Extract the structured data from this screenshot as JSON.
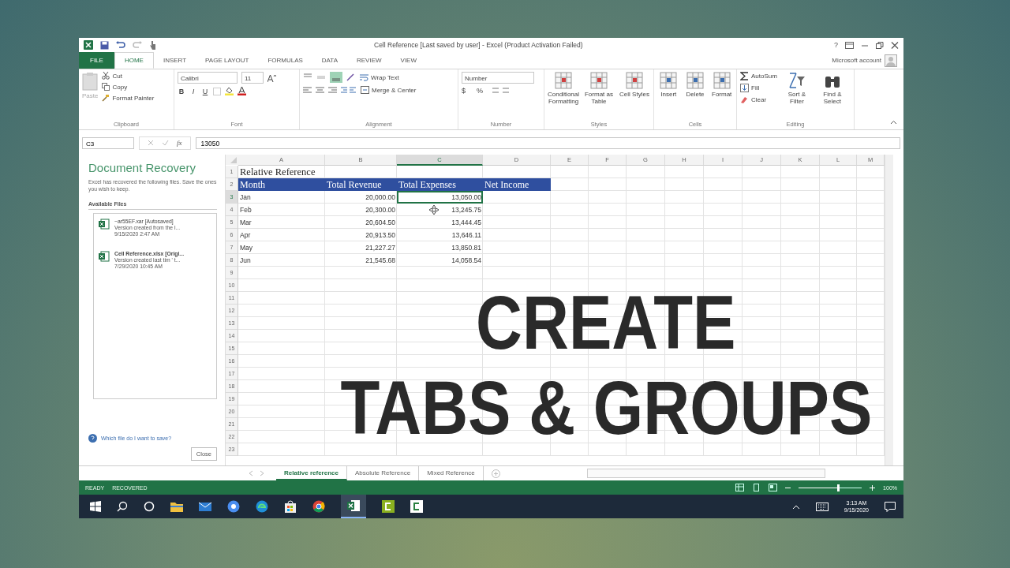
{
  "window": {
    "title": "Cell Reference [Last saved by user] - Excel (Product Activation Failed)",
    "help": "?",
    "account": "Microsoft account"
  },
  "ribbon_tabs": [
    {
      "label": "FILE",
      "kind": "file",
      "selected": false
    },
    {
      "label": "HOME",
      "kind": "tab",
      "selected": true
    },
    {
      "label": "INSERT",
      "kind": "tab",
      "selected": false
    },
    {
      "label": "PAGE LAYOUT",
      "kind": "tab",
      "selected": false
    },
    {
      "label": "FORMULAS",
      "kind": "tab",
      "selected": false
    },
    {
      "label": "DATA",
      "kind": "tab",
      "selected": false
    },
    {
      "label": "REVIEW",
      "kind": "tab",
      "selected": false
    },
    {
      "label": "VIEW",
      "kind": "tab",
      "selected": false
    }
  ],
  "ribbon_groups": [
    {
      "kind": "clipboard",
      "label": "Clipboard",
      "paste": "Paste",
      "items": [
        "Cut",
        "Copy",
        "Format Painter"
      ]
    },
    {
      "kind": "font",
      "label": "Font",
      "font": "Calibri",
      "size": "11",
      "styles": [
        "B",
        "I",
        "U"
      ]
    },
    {
      "kind": "alignment",
      "label": "Alignment",
      "items": [
        "Wrap Text",
        "Merge & Center"
      ]
    },
    {
      "kind": "number",
      "label": "Number",
      "format": "Number",
      "symbols": [
        "$",
        "%"
      ]
    },
    {
      "kind": "large",
      "label": "Styles",
      "items": [
        "Conditional Formatting",
        "Format as Table",
        "Cell Styles"
      ]
    },
    {
      "kind": "large",
      "label": "Cells",
      "items": [
        "Insert",
        "Delete",
        "Format"
      ]
    },
    {
      "kind": "editing",
      "label": "Editing",
      "items": [
        "AutoSum",
        "Fill",
        "Clear"
      ],
      "large": [
        "Sort & Filter",
        "Find & Select"
      ]
    }
  ],
  "formula_bar": {
    "name_box": "C3",
    "fx": "fx",
    "value": "13050"
  },
  "recovery": {
    "title": "Document Recovery",
    "description": "Excel has recovered the following files. Save the ones you wish to keep.",
    "list_label": "Available Files",
    "files": [
      {
        "name": "~ar55EF.xar  [Autosaved]",
        "note": "Version created from the l...",
        "time": "9/15/2020 2:47 AM"
      },
      {
        "name": "Cell Reference.xlsx  [Origi...",
        "note": "Version created last tim ' t...",
        "time": "7/29/2020 10:45 AM"
      }
    ],
    "help": "Which file do I want to save?",
    "close": "Close"
  },
  "sheet": {
    "columns": [
      {
        "label": "A",
        "selected": false
      },
      {
        "label": "B",
        "selected": false
      },
      {
        "label": "C",
        "selected": true
      },
      {
        "label": "D",
        "selected": false
      },
      {
        "label": "E",
        "selected": false
      },
      {
        "label": "F",
        "selected": false
      },
      {
        "label": "G",
        "selected": false
      },
      {
        "label": "H",
        "selected": false
      },
      {
        "label": "I",
        "selected": false
      },
      {
        "label": "J",
        "selected": false
      },
      {
        "label": "K",
        "selected": false
      },
      {
        "label": "L",
        "selected": false
      },
      {
        "label": "M",
        "selected": false
      }
    ],
    "rows": [
      {
        "number": "1",
        "kind": "title",
        "selected": false,
        "cells": [
          "Relative Reference"
        ]
      },
      {
        "number": "2",
        "kind": "header",
        "selected": false,
        "cells": [
          "Month",
          "Total Revenue",
          "Total Expenses",
          "Net Income"
        ]
      },
      {
        "number": "3",
        "kind": "data",
        "selected": true,
        "cells": [
          "Jan",
          "20,000.00",
          "13,050.00"
        ]
      },
      {
        "number": "4",
        "kind": "data",
        "selected": false,
        "cells": [
          "Feb",
          "20,300.00",
          "13,245.75"
        ]
      },
      {
        "number": "5",
        "kind": "data",
        "selected": false,
        "cells": [
          "Mar",
          "20,604.50",
          "13,444.45"
        ]
      },
      {
        "number": "6",
        "kind": "data",
        "selected": false,
        "cells": [
          "Apr",
          "20,913.50",
          "13,646.11"
        ]
      },
      {
        "number": "7",
        "kind": "data",
        "selected": false,
        "cells": [
          "May",
          "21,227.27",
          "13,850.81"
        ]
      },
      {
        "number": "8",
        "kind": "data",
        "selected": false,
        "cells": [
          "Jun",
          "21,545.68",
          "14,058.54"
        ]
      },
      {
        "number": "9",
        "kind": "empty",
        "selected": false
      },
      {
        "number": "10",
        "kind": "empty",
        "selected": false
      },
      {
        "number": "11",
        "kind": "empty",
        "selected": false
      },
      {
        "number": "12",
        "kind": "empty",
        "selected": false
      },
      {
        "number": "13",
        "kind": "empty",
        "selected": false
      },
      {
        "number": "14",
        "kind": "empty",
        "selected": false
      },
      {
        "number": "15",
        "kind": "empty",
        "selected": false
      },
      {
        "number": "16",
        "kind": "empty",
        "selected": false
      },
      {
        "number": "17",
        "kind": "empty",
        "selected": false
      },
      {
        "number": "18",
        "kind": "empty",
        "selected": false
      },
      {
        "number": "19",
        "kind": "empty",
        "selected": false
      },
      {
        "number": "20",
        "kind": "empty",
        "selected": false
      },
      {
        "number": "21",
        "kind": "empty",
        "selected": false
      },
      {
        "number": "22",
        "kind": "empty",
        "selected": false
      },
      {
        "number": "23",
        "kind": "empty",
        "selected": false
      }
    ]
  },
  "sheet_tabs": [
    {
      "label": "Relative reference",
      "selected": true
    },
    {
      "label": "Absolute Reference",
      "selected": false
    },
    {
      "label": "Mixed Reference",
      "selected": false
    }
  ],
  "status_bar": {
    "items": [
      "READY",
      "RECOVERED"
    ],
    "zoom": "100%",
    "level": 0.62
  },
  "taskbar": {
    "time": "3:13 AM",
    "date": "9/15/2020"
  },
  "overlay": [
    "CREATE",
    "TABS & GROUPS"
  ]
}
